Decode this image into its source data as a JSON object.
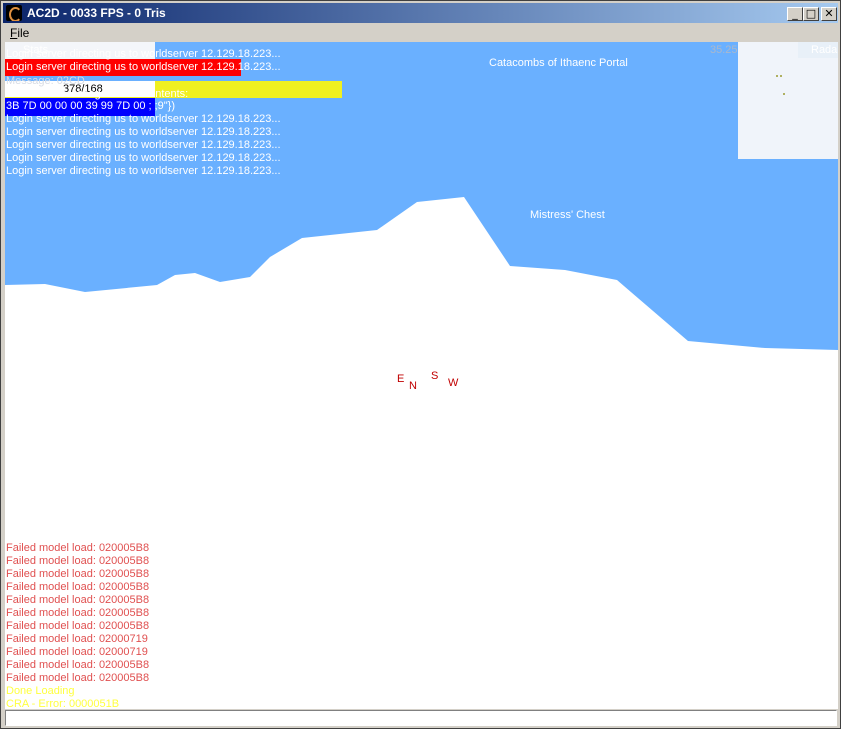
{
  "window": {
    "title": "AC2D - 0033 FPS - 0 Tris",
    "minimize_glyph": "_",
    "maximize_glyph": "□",
    "close_glyph": "✕"
  },
  "menu": {
    "file_accel": "F",
    "file_rest": "ile"
  },
  "hud": {
    "stats_label": "Stats",
    "radar_label": "Radar",
    "radar_coord": "35.25",
    "health_value": "378/168",
    "message_label": "Message: 02CD",
    "unhandled_label": "Unhandled Message 02CD Contents:",
    "hex_line": "3B 7D 00 00 00 39 99 7D 00 ; ;9\"})"
  },
  "chat_lines": [
    "Login server directing us to worldserver 12.129.18.223...",
    "Login server directing us to worldserver 12.129.18.223...",
    "Login server directing us to worldserver 12.129.18.223...",
    "Login server directing us to worldserver 12.129.18.223...",
    "Login server directing us to worldserver 12.129.18.223...",
    "Login server directing us to worldserver 12.129.18.223...",
    "Login server directing us to worldserver 12.129.18.223...",
    "Login server directing us to worldserver 12.129.18.223..."
  ],
  "world_labels": {
    "portal": "Catacombs of Ithaenc Portal",
    "chest": "Mistress' Chest"
  },
  "compass": {
    "e": "E",
    "n": "N",
    "s": "S",
    "w": "W"
  },
  "error_lines": [
    "Failed model load: 020005B8",
    "Failed model load: 020005B8",
    "Failed model load: 020005B8",
    "Failed model load: 020005B8",
    "Failed model load: 020005B8",
    "Failed model load: 020005B8",
    "Failed model load: 020005B8",
    "Failed model load: 02000719",
    "Failed model load: 02000719",
    "Failed model load: 020005B8",
    "Failed model load: 020005B8"
  ],
  "status_lines": [
    "Done Loading",
    "CRA - Error: 0000051B"
  ],
  "colors": {
    "sky": "#6ab0ff",
    "terrain": "#ffffff",
    "error_text": "#e05050",
    "status_text": "#ffff40",
    "health_bar": "#ff0000",
    "stamina_bar": "#f0f020",
    "mana_bar": "#0000ff"
  },
  "icons": {
    "app": "ac2d-app-icon"
  }
}
